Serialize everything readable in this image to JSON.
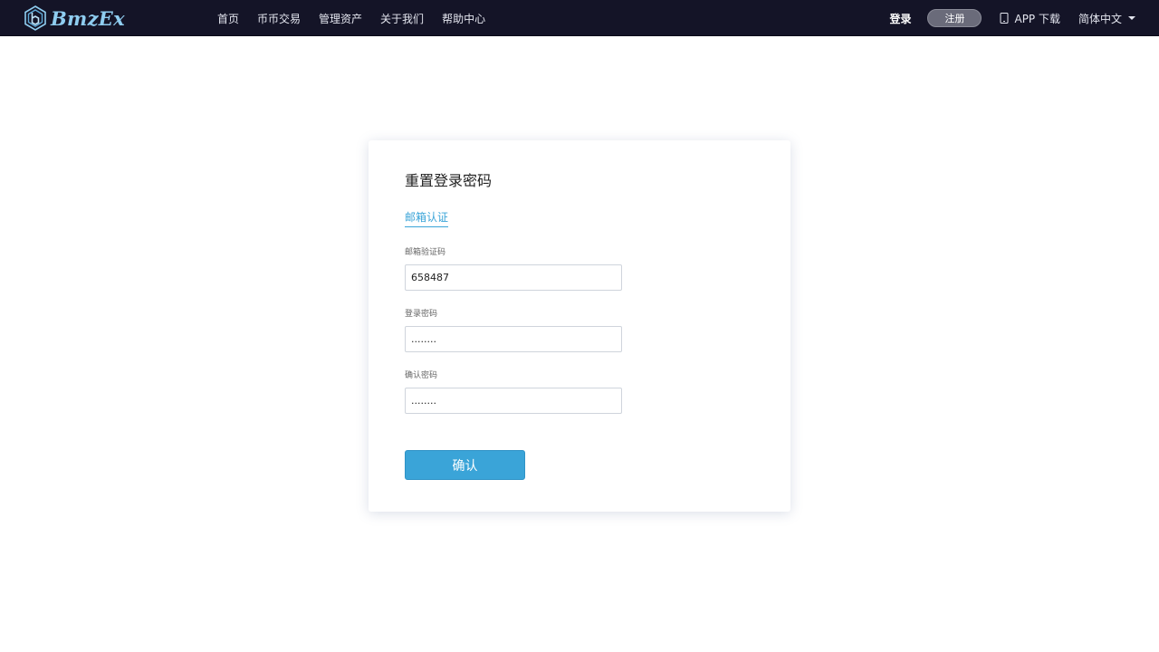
{
  "header": {
    "brand": "BmzEx",
    "nav": [
      {
        "label": "首页"
      },
      {
        "label": "币币交易"
      },
      {
        "label": "管理资产"
      },
      {
        "label": "关于我们"
      },
      {
        "label": "帮助中心"
      }
    ],
    "login_label": "登录",
    "register_label": "注册",
    "app_download_label": "APP 下载",
    "language_label": "简体中文"
  },
  "form": {
    "title": "重置登录密码",
    "tab_label": "邮箱认证",
    "email_code_label": "邮箱验证码",
    "email_code_value": "658487",
    "password_label": "登录密码",
    "password_value": "........",
    "confirm_password_label": "确认密码",
    "confirm_password_value": "........",
    "submit_label": "确认"
  },
  "colors": {
    "header_bg": "#141427",
    "accent": "#3aa4d8",
    "logo": "#8fcdf0"
  }
}
